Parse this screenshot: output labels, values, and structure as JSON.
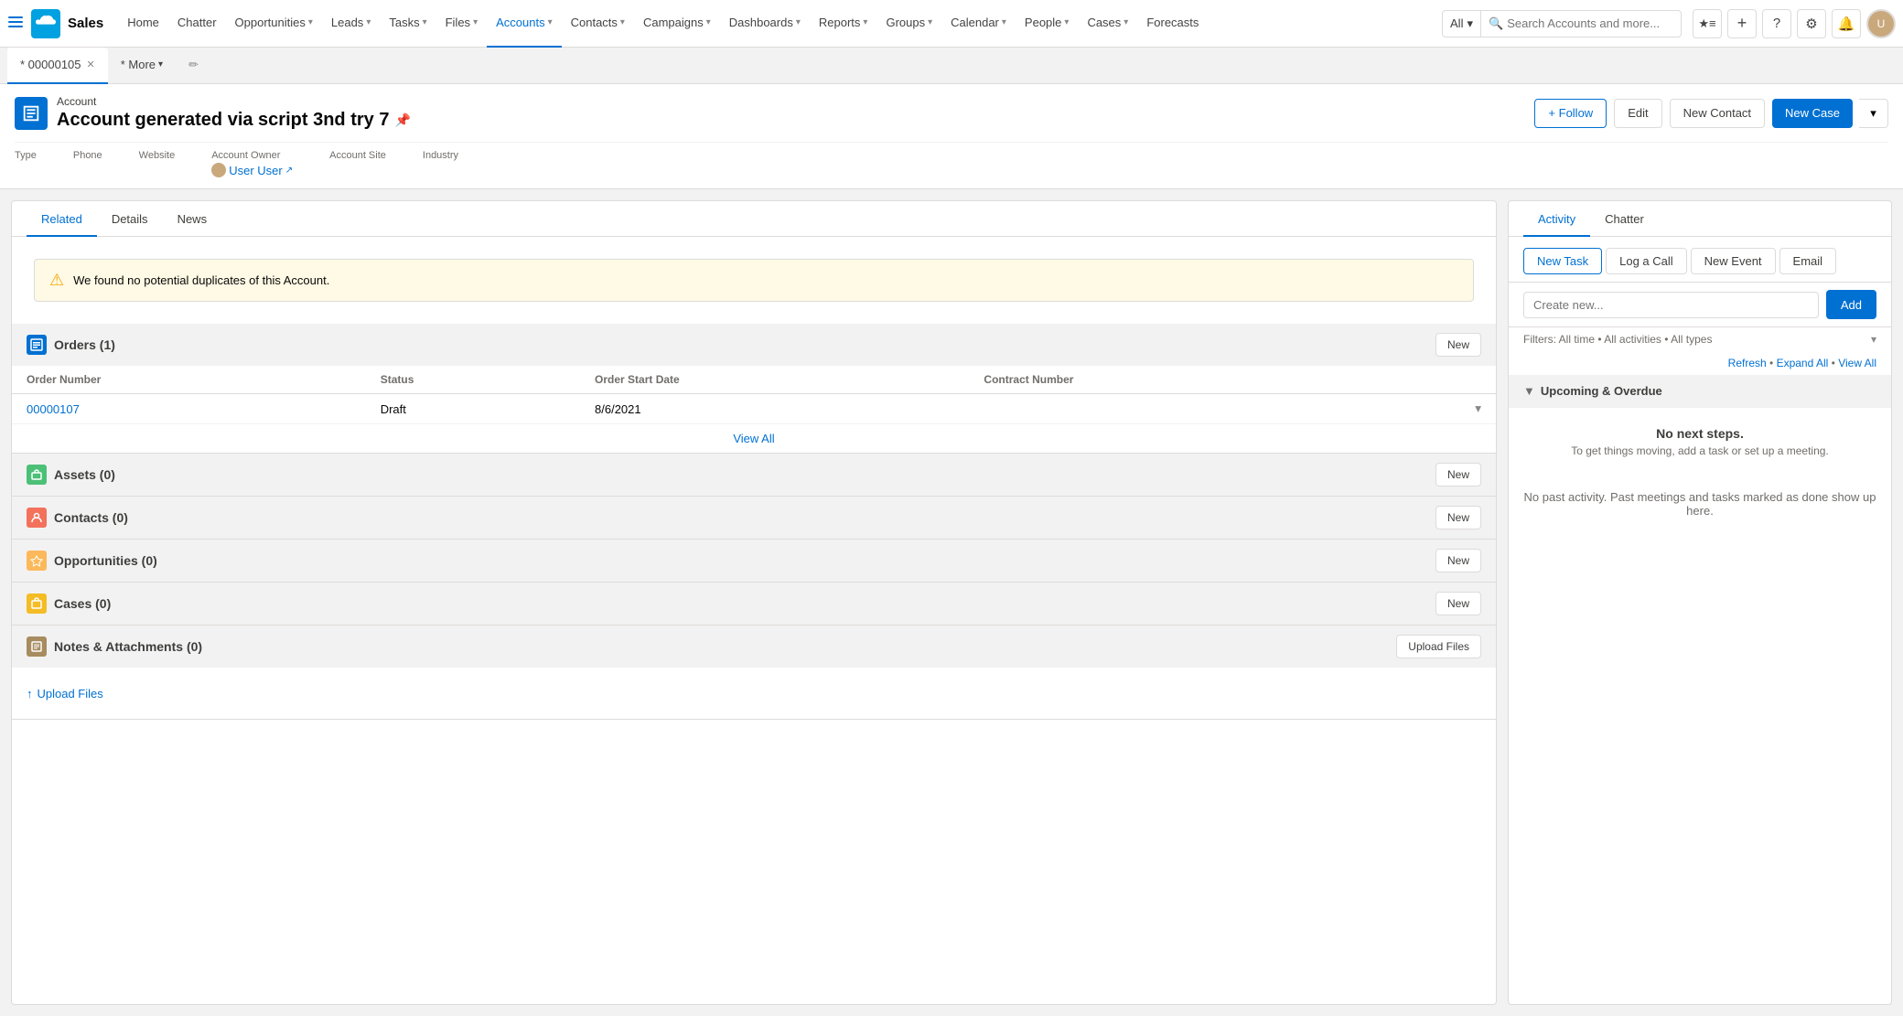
{
  "app": {
    "name": "Sales"
  },
  "topnav": {
    "items": [
      {
        "label": "Home",
        "has_chevron": false
      },
      {
        "label": "Chatter",
        "has_chevron": false
      },
      {
        "label": "Opportunities",
        "has_chevron": true
      },
      {
        "label": "Leads",
        "has_chevron": true
      },
      {
        "label": "Tasks",
        "has_chevron": true
      },
      {
        "label": "Files",
        "has_chevron": true
      },
      {
        "label": "Accounts",
        "has_chevron": true,
        "active": true
      },
      {
        "label": "Contacts",
        "has_chevron": true
      },
      {
        "label": "Campaigns",
        "has_chevron": true
      },
      {
        "label": "Dashboards",
        "has_chevron": true
      },
      {
        "label": "Reports",
        "has_chevron": true
      },
      {
        "label": "Groups",
        "has_chevron": true
      },
      {
        "label": "Calendar",
        "has_chevron": true
      },
      {
        "label": "People",
        "has_chevron": true
      },
      {
        "label": "Cases",
        "has_chevron": true
      },
      {
        "label": "Forecasts",
        "has_chevron": false
      }
    ],
    "tab_items": [
      {
        "label": "* 00000105",
        "closeable": true,
        "active": true
      },
      {
        "label": "* More",
        "has_chevron": true
      }
    ],
    "search_scope": "All",
    "search_placeholder": "Search Accounts and more...",
    "icons": {
      "star_list": "★≡",
      "add": "+",
      "help": "?",
      "settings": "⚙",
      "bell": "🔔"
    }
  },
  "page_header": {
    "breadcrumb": "Account",
    "title": "Account generated via script 3nd try 7",
    "follow_label": "+ Follow",
    "edit_label": "Edit",
    "new_contact_label": "New Contact",
    "new_case_label": "New Case",
    "fields": [
      {
        "label": "Type",
        "value": "",
        "is_link": false
      },
      {
        "label": "Phone",
        "value": "",
        "is_link": false
      },
      {
        "label": "Website",
        "value": "",
        "is_link": false
      },
      {
        "label": "Account Owner",
        "value": "User User",
        "is_link": true
      },
      {
        "label": "Account Site",
        "value": "",
        "is_link": false
      },
      {
        "label": "Industry",
        "value": "",
        "is_link": false
      }
    ]
  },
  "left_panel": {
    "tabs": [
      {
        "label": "Related",
        "active": true
      },
      {
        "label": "Details",
        "active": false
      },
      {
        "label": "News",
        "active": false
      }
    ],
    "alert": "We found no potential duplicates of this Account.",
    "sections": [
      {
        "id": "orders",
        "title": "Orders (1)",
        "icon_class": "icon-orders",
        "icon_symbol": "📋",
        "action_label": "New",
        "has_table": true,
        "columns": [
          "Order Number",
          "Status",
          "Order Start Date",
          "Contract Number"
        ],
        "rows": [
          {
            "cells": [
              "00000107",
              "Draft",
              "8/6/2021",
              ""
            ],
            "is_link_first": true
          }
        ],
        "view_all": "View All"
      },
      {
        "id": "assets",
        "title": "Assets (0)",
        "icon_class": "icon-assets",
        "icon_symbol": "📦",
        "action_label": "New",
        "has_table": false
      },
      {
        "id": "contacts",
        "title": "Contacts (0)",
        "icon_class": "icon-contacts",
        "icon_symbol": "👤",
        "action_label": "New",
        "has_table": false
      },
      {
        "id": "opportunities",
        "title": "Opportunities (0)",
        "icon_class": "icon-opportunities",
        "icon_symbol": "💰",
        "action_label": "New",
        "has_table": false
      },
      {
        "id": "cases",
        "title": "Cases (0)",
        "icon_class": "icon-cases",
        "icon_symbol": "🗂",
        "action_label": "New",
        "has_table": false
      },
      {
        "id": "notes",
        "title": "Notes & Attachments (0)",
        "icon_class": "icon-notes",
        "icon_symbol": "📎",
        "action_label": "Upload Files",
        "action_type": "upload",
        "has_table": false
      }
    ],
    "upload_files_label": "Upload Files"
  },
  "right_panel": {
    "tabs": [
      {
        "label": "Activity",
        "active": true
      },
      {
        "label": "Chatter",
        "active": false
      }
    ],
    "action_buttons": [
      {
        "label": "New Task",
        "primary": true
      },
      {
        "label": "Log a Call",
        "primary": false
      },
      {
        "label": "New Event",
        "primary": false
      },
      {
        "label": "Email",
        "primary": false
      }
    ],
    "create_placeholder": "Create new...",
    "add_label": "Add",
    "filters_text": "Filters: All time • All activities • All types",
    "refresh_label": "Refresh",
    "expand_all_label": "Expand All",
    "view_all_label": "View All",
    "upcoming_title": "Upcoming & Overdue",
    "no_steps_title": "No next steps.",
    "no_steps_sub": "To get things moving, add a task or set up a meeting.",
    "past_activity": "No past activity. Past meetings and tasks marked as done show up here."
  },
  "bottom_bar": {
    "upload_label": "Upload Files"
  }
}
